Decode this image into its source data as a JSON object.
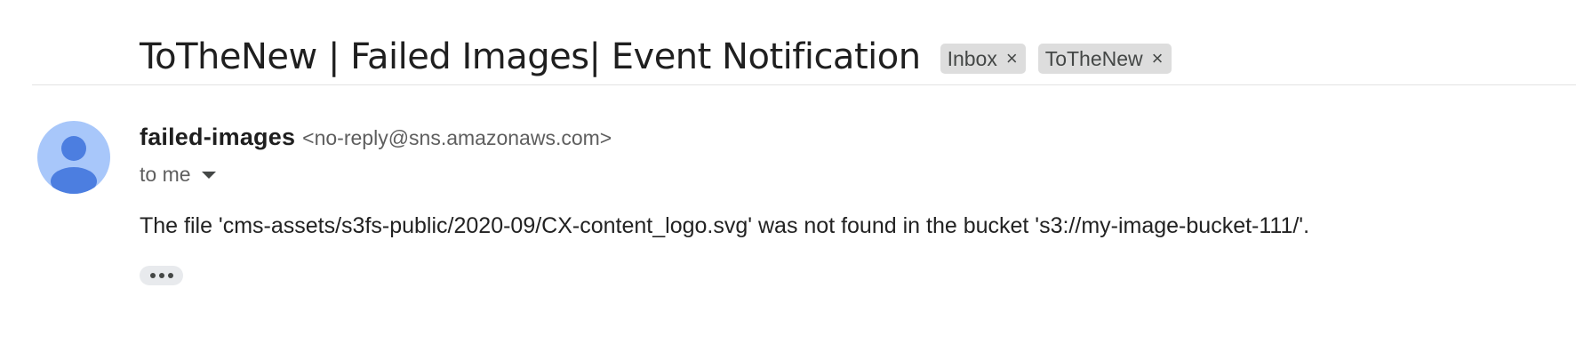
{
  "email": {
    "subject": "ToTheNew | Failed Images| Event Notification",
    "labels": [
      {
        "name": "Inbox",
        "close_glyph": "×"
      },
      {
        "name": "ToTheNew",
        "close_glyph": "×"
      }
    ],
    "sender": {
      "name": "failed-images",
      "email": "<no-reply@sns.amazonaws.com>"
    },
    "recipient_text": "to me",
    "body": "The file 'cms-assets/s3fs-public/2020-09/CX-content_logo.svg' was not found in the bucket 's3://my-image-bucket-111/'.",
    "more_icon": "more-horizontal-icon"
  },
  "colors": {
    "avatar_bg": "#a8c7fa",
    "avatar_figure": "#4c7ee0",
    "chip_bg": "#dddddd"
  }
}
